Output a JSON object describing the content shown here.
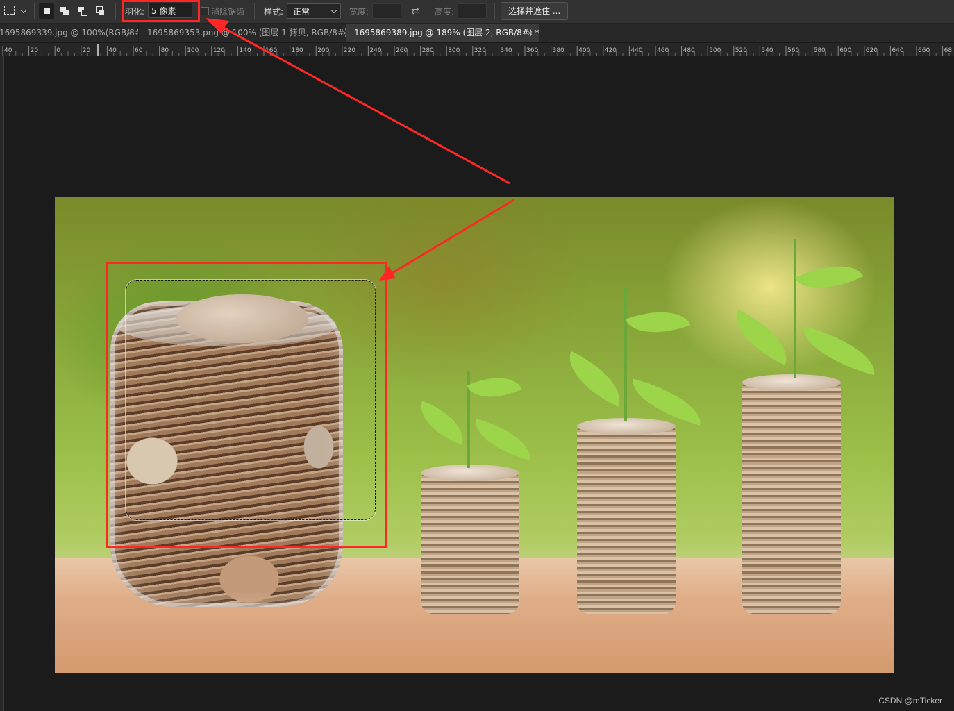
{
  "options_bar": {
    "feather_label": "羽化:",
    "feather_value": "5 像素",
    "antialias_label": "消除锯齿",
    "style_label": "样式:",
    "style_value": "正常",
    "width_label": "宽度:",
    "height_label": "高度:",
    "select_mask_button": "选择并遮住 ..."
  },
  "tabs": [
    {
      "label": "1695869339.jpg @ 100%(RGB/8#)",
      "close": "×",
      "active": false
    },
    {
      "label": "1695869353.png @ 100% (图层 1 拷贝, RGB/8#) *",
      "close": "×",
      "active": false
    },
    {
      "label": "1695869389.jpg @ 189% (图层 2, RGB/8#) *",
      "close": "×",
      "active": true
    }
  ],
  "ruler": {
    "labels": [
      "40",
      "20",
      "0",
      "20",
      "40",
      "60",
      "80",
      "100",
      "120",
      "140",
      "160",
      "180",
      "200",
      "220",
      "240",
      "260",
      "280",
      "300",
      "320",
      "340",
      "360",
      "380",
      "400",
      "420",
      "440",
      "460",
      "480",
      "500",
      "520",
      "540",
      "560",
      "580",
      "600",
      "620",
      "640",
      "660",
      "68"
    ]
  },
  "colors": {
    "annotation_red": "#ff2626",
    "ui_background": "#1b1b1b",
    "panel": "#323232"
  },
  "watermark": "CSDN @mTicker"
}
